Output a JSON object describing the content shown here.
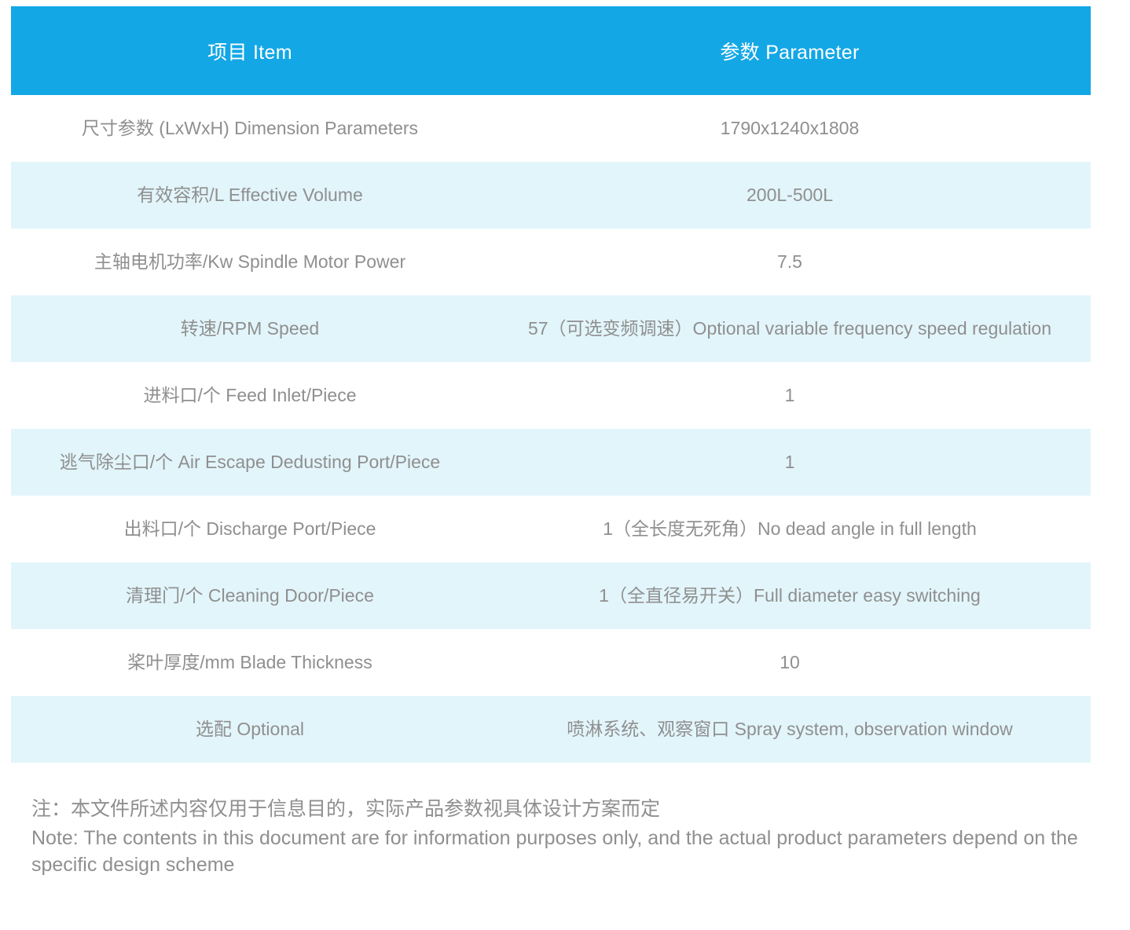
{
  "theme": {
    "header_bg": "#13a7e6",
    "header_text": "#ffffff",
    "row_tint_bg": "#e2f5fb",
    "row_plain_bg": "#ffffff",
    "body_text": "#8f8f8f"
  },
  "table": {
    "headers": {
      "item": "项目 Item",
      "parameter": "参数 Parameter"
    },
    "rows": [
      {
        "item": "尺寸参数 (LxWxH) Dimension Parameters",
        "parameter": "1790x1240x1808"
      },
      {
        "item": "有效容积/L Effective Volume",
        "parameter": "200L-500L"
      },
      {
        "item": "主轴电机功率/Kw Spindle Motor Power",
        "parameter": "7.5"
      },
      {
        "item": "转速/RPM Speed",
        "parameter": "57（可选变频调速）Optional variable frequency speed regulation"
      },
      {
        "item": "进料口/个 Feed Inlet/Piece",
        "parameter": "1"
      },
      {
        "item": "逃气除尘口/个 Air Escape Dedusting Port/Piece",
        "parameter": "1"
      },
      {
        "item": "出料口/个 Discharge Port/Piece",
        "parameter": "1（全长度无死角）No dead angle in full length"
      },
      {
        "item": "清理门/个 Cleaning Door/Piece",
        "parameter": "1（全直径易开关）Full diameter easy switching"
      },
      {
        "item": "桨叶厚度/mm Blade Thickness",
        "parameter": "10"
      },
      {
        "item": "选配 Optional",
        "parameter": "喷淋系统、观察窗口 Spray system, observation window"
      }
    ]
  },
  "note": {
    "chinese": "注：本文件所述内容仅用于信息目的，实际产品参数视具体设计方案而定",
    "english": "Note: The contents in this document are for information purposes only, and the actual product parameters depend on the specific design scheme"
  }
}
